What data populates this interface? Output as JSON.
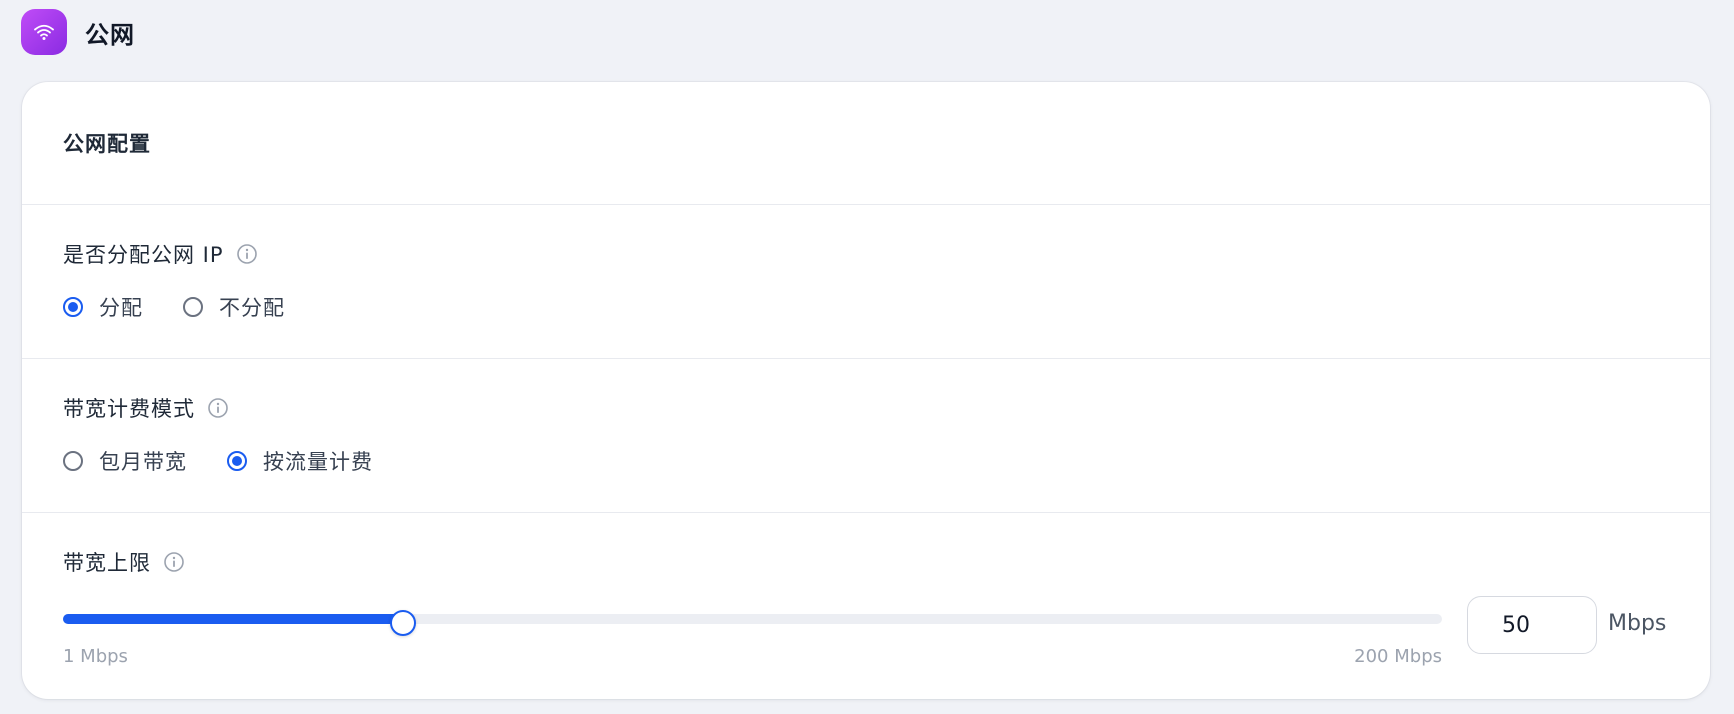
{
  "header": {
    "icon": "wifi-icon",
    "title": "公网",
    "accent_gradient": [
      "#c04cf7",
      "#8a2be2"
    ]
  },
  "card": {
    "title": "公网配置"
  },
  "public_ip": {
    "label": "是否分配公网 IP",
    "options": [
      {
        "label": "分配",
        "checked": true
      },
      {
        "label": "不分配",
        "checked": false
      }
    ]
  },
  "billing": {
    "label": "带宽计费模式",
    "options": [
      {
        "label": "包月带宽",
        "checked": false
      },
      {
        "label": "按流量计费",
        "checked": true
      }
    ]
  },
  "bandwidth": {
    "label": "带宽上限",
    "min": 1,
    "max": 200,
    "value": 50,
    "min_label": "1 Mbps",
    "max_label": "200 Mbps",
    "input_value": "50",
    "unit": "Mbps"
  },
  "colors": {
    "primary": "#1a5cf0",
    "background": "#f0f2f7"
  }
}
